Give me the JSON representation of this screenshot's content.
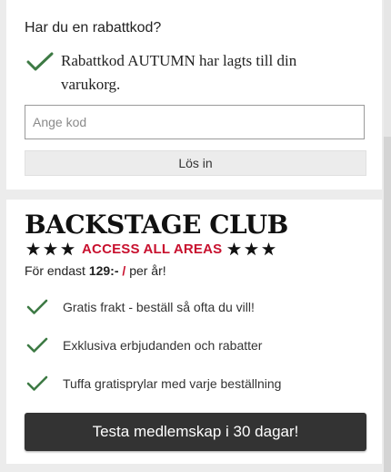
{
  "coupon": {
    "question": "Har du en rabattkod?",
    "success_icon": "check-icon",
    "success_message": "Rabattkod AUTUMN har lagts till din varukorg.",
    "input_value": "",
    "input_placeholder": "Ange kod",
    "redeem_label": "Lös in"
  },
  "club": {
    "title": "BACKSTAGE CLUB",
    "tagline": "ACCESS ALL AREAS",
    "star_icon": "star-icon",
    "price_prefix": "För endast",
    "price_amount": "129:-",
    "price_separator": "/",
    "price_suffix": "per år!",
    "benefits": [
      {
        "label": "Gratis frakt - beställ så ofta du vill!",
        "icon": "check-icon"
      },
      {
        "label": "Exklusiva erbjudanden och rabatter",
        "icon": "check-icon"
      },
      {
        "label": "Tuffa gratisprylar med varje beställning",
        "icon": "check-icon"
      }
    ],
    "cta_label": "Testa medlemskap i 30 dagar!"
  },
  "colors": {
    "check": "#3d7a44",
    "accent_red": "#c8102e",
    "cta_background": "#333333",
    "page_background": "#ececec"
  }
}
